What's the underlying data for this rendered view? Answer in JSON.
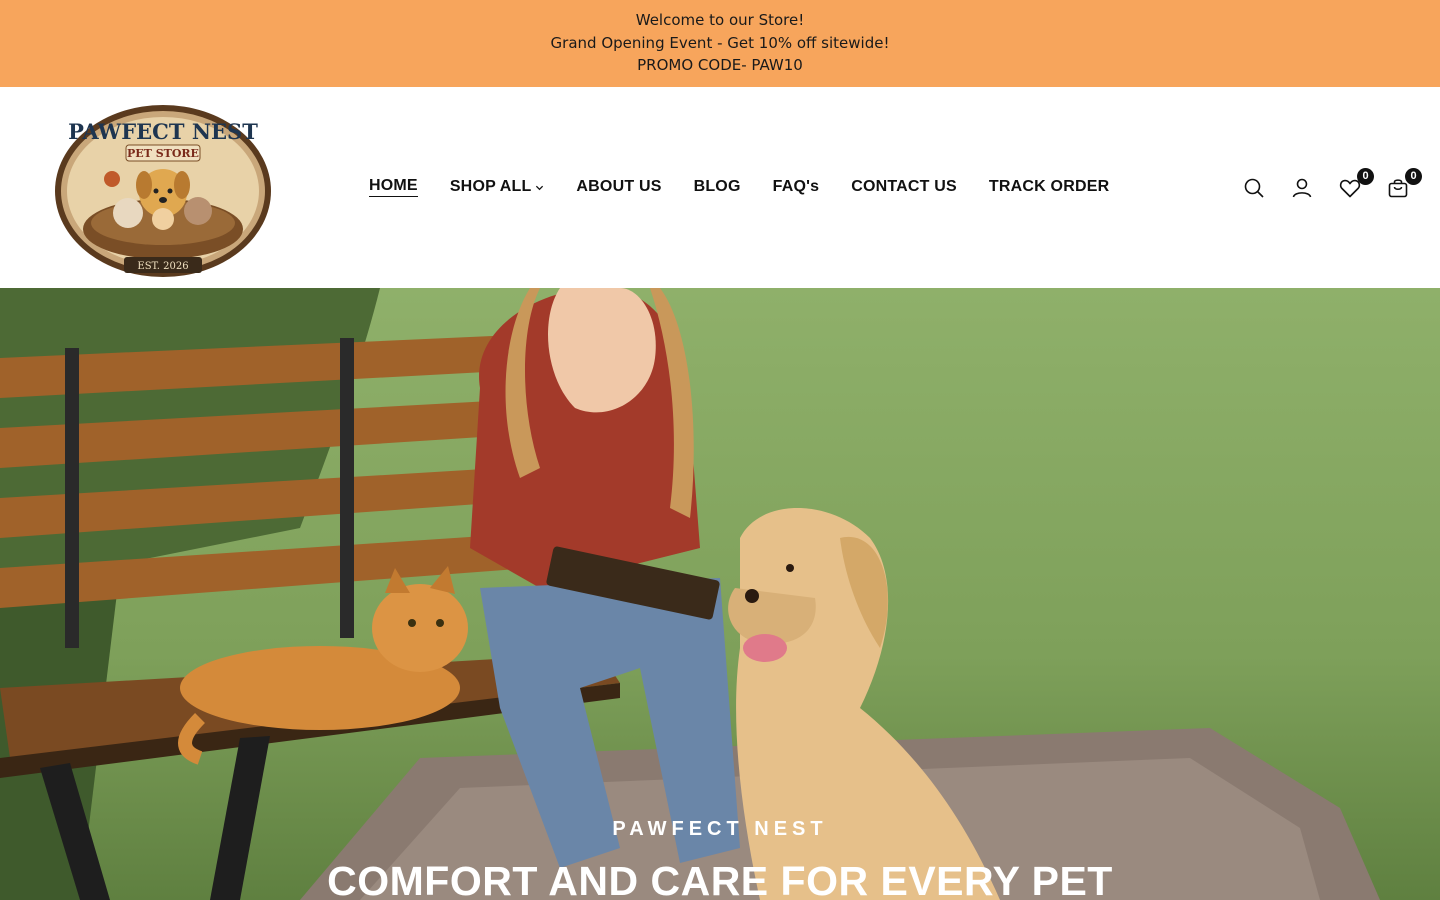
{
  "announcement": {
    "line1": "Welcome to our Store!",
    "line2": "Grand Opening Event - Get 10% off sitewide!",
    "line3": "PROMO CODE- PAW10",
    "bg_color": "#f7a55c"
  },
  "logo": {
    "text_top": "PAWFECT NEST",
    "text_sub": "PET STORE",
    "text_est": "EST. 2026"
  },
  "nav": {
    "items": [
      {
        "label": "HOME"
      },
      {
        "label": "SHOP ALL"
      },
      {
        "label": "ABOUT US"
      },
      {
        "label": "BLOG"
      },
      {
        "label": "FAQ's"
      },
      {
        "label": "CONTACT US"
      },
      {
        "label": "TRACK ORDER"
      }
    ]
  },
  "header_icons": {
    "search": "search-icon",
    "account": "user-icon",
    "wishlist": "heart-icon",
    "wishlist_count": "0",
    "cart": "bag-icon",
    "cart_count": "0"
  },
  "hero": {
    "kicker": "PAWFECT NEST",
    "title": "COMFORT AND CARE FOR EVERY PET"
  }
}
